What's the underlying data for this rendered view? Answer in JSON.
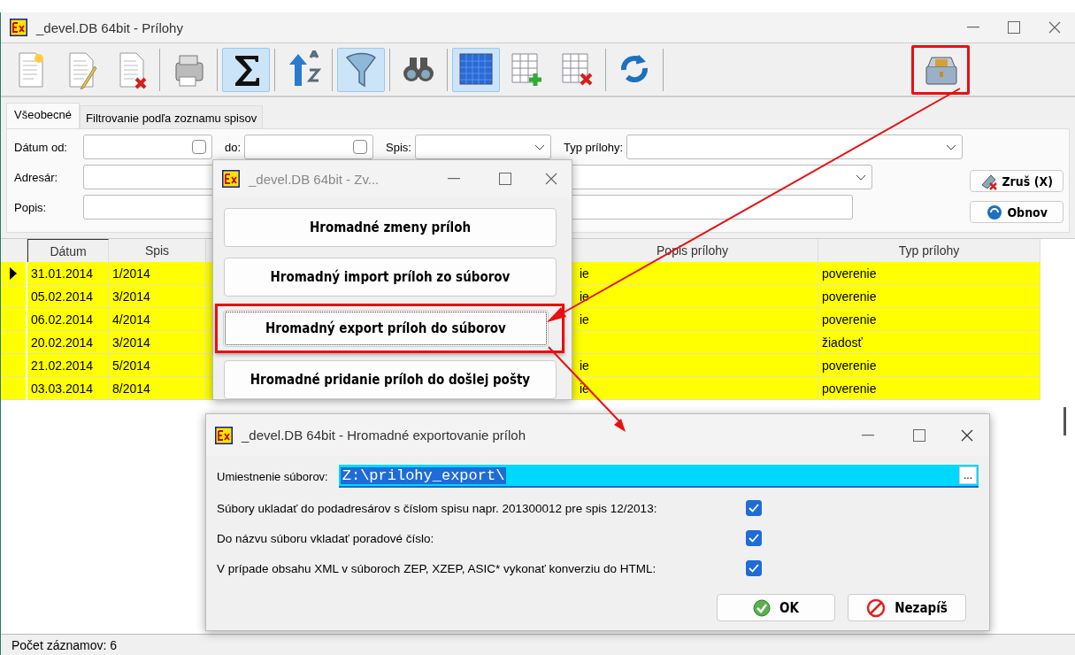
{
  "window": {
    "title": "_devel.DB 64bit - Prílohy"
  },
  "toolbar": [
    {
      "kind": "new-doc",
      "active": false
    },
    {
      "kind": "edit-doc",
      "active": false
    },
    {
      "kind": "delete-doc",
      "active": false
    },
    {
      "kind": "sep"
    },
    {
      "kind": "printer",
      "active": false
    },
    {
      "kind": "sep"
    },
    {
      "kind": "sigma",
      "active": true
    },
    {
      "kind": "sep"
    },
    {
      "kind": "sort",
      "active": false
    },
    {
      "kind": "sep"
    },
    {
      "kind": "funnel",
      "active": true
    },
    {
      "kind": "sep"
    },
    {
      "kind": "binoculars",
      "active": false
    },
    {
      "kind": "sep"
    },
    {
      "kind": "grid",
      "active": true
    },
    {
      "kind": "grid-add",
      "active": false
    },
    {
      "kind": "grid-delete",
      "active": false
    },
    {
      "kind": "sep"
    },
    {
      "kind": "refresh",
      "active": false
    },
    {
      "kind": "sep"
    },
    {
      "kind": "spacer"
    },
    {
      "kind": "toolbox",
      "active": false,
      "marked": true
    }
  ],
  "tabs": [
    {
      "label": "Všeobecné",
      "selected": true
    },
    {
      "label": "Filtrovanie podľa zoznamu spisov",
      "selected": false
    }
  ],
  "filters": [
    [
      {
        "label": "Dátum od:",
        "kind": "date",
        "checked": false
      },
      {
        "label": "do:",
        "kind": "date",
        "checked": false
      },
      {
        "label": "Spis:",
        "kind": "combo"
      },
      {
        "label": "Typ prílohy:",
        "kind": "combo-wide"
      }
    ],
    [
      {
        "label": "Adresár:",
        "kind": "combo-long"
      }
    ],
    [
      {
        "label": "Popis:",
        "kind": "text-long"
      }
    ]
  ],
  "filter_buttons": [
    {
      "label": "Zruš (X)",
      "kind": "clear"
    },
    {
      "label": "Obnov",
      "kind": "refresh"
    }
  ],
  "grid": {
    "columns": [
      {
        "label": "Dátum",
        "sorted": true
      },
      {
        "label": "Spis",
        "sorted": false
      },
      {
        "label": "Popis prílohy",
        "sorted": false
      },
      {
        "label": "Typ prílohy",
        "sorted": false
      }
    ],
    "rows": [
      {
        "date": "31.01.2014",
        "spis": "1/2014",
        "popis": "ie",
        "typ": "poverenie",
        "selected": true
      },
      {
        "date": "05.02.2014",
        "spis": "3/2014",
        "popis": "ie",
        "typ": "poverenie",
        "selected": false
      },
      {
        "date": "06.02.2014",
        "spis": "4/2014",
        "popis": "ie",
        "typ": "poverenie",
        "selected": false
      },
      {
        "date": "20.02.2014",
        "spis": "3/2014",
        "typ": "žiadosť",
        "selected": false
      },
      {
        "date": "21.02.2014",
        "spis": "5/2014",
        "popis": "ie",
        "typ": "poverenie",
        "selected": false
      },
      {
        "date": "03.03.2014",
        "spis": "8/2014",
        "popis": "ie",
        "typ": "poverenie",
        "selected": false
      }
    ]
  },
  "status_bar": "Počet záznamov: 6",
  "menu_dialog": {
    "title": "_devel.DB 64bit - Zv...",
    "buttons": [
      {
        "label": "Hromadné zmeny príloh",
        "marked": false
      },
      {
        "label": "Hromadný import príloh zo súborov",
        "marked": false
      },
      {
        "label": "Hromadný export príloh do súborov",
        "marked": true
      },
      {
        "label": "Hromadné pridanie príloh do došlej pošty",
        "marked": false
      }
    ]
  },
  "export_dialog": {
    "title": "_devel.DB 64bit - Hromadné exportovanie príloh",
    "location": {
      "label": "Umiestnenie súborov:",
      "value": "Z:\\prilohy_export\\",
      "browse": "..."
    },
    "options": [
      {
        "label": "Súbory ukladať do podadresárov s číslom spisu napr. 201300012 pre spis 12/2013:",
        "checked": true
      },
      {
        "label": "Do názvu súboru vkladať poradové číslo:",
        "checked": true
      },
      {
        "label": "V prípade obsahu XML v súboroch ZEP, XZEP, ASIC* vykonať konverziu do HTML:",
        "checked": true
      }
    ],
    "buttons": [
      {
        "label": "OK",
        "kind": "ok"
      },
      {
        "label": "Nezapíš",
        "kind": "cancel"
      }
    ]
  }
}
